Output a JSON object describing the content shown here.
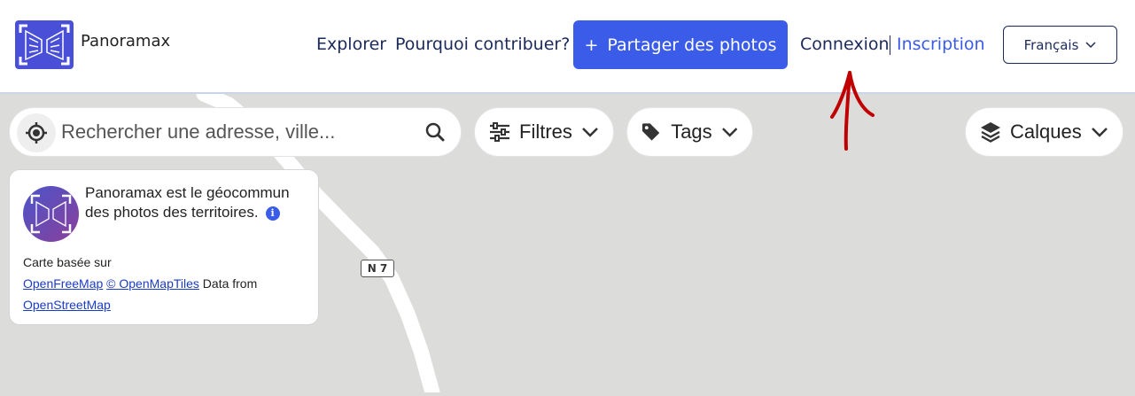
{
  "header": {
    "brand": "Panoramax",
    "nav": {
      "explore": "Explorer",
      "why": "Pourquoi contribuer?",
      "share": "Partager des photos",
      "share_plus": "+",
      "login": "Connexion",
      "signup": "Inscription"
    },
    "language": "Français"
  },
  "map": {
    "search_placeholder": "Rechercher une adresse, ville...",
    "filters_label": "Filtres",
    "tags_label": "Tags",
    "layers_label": "Calques",
    "road_label": "N 7"
  },
  "card": {
    "title": "Panoramax est le géocommun des photos des territoires.",
    "attribution_prefix": "Carte basée sur",
    "link_openfreemap": "OpenFreeMap",
    "link_openmaptiles": "© OpenMapTiles",
    "data_from": "Data from",
    "link_osm": "OpenStreetMap"
  },
  "colors": {
    "accent": "#3a5ce9",
    "navy": "#1b2a5a",
    "map_bg": "#dcdddb",
    "annotation": "#c00000"
  },
  "icons": [
    "panoramax-logo-icon",
    "locate-icon",
    "search-icon",
    "filters-icon",
    "tag-icon",
    "layers-icon",
    "chevron-down-icon",
    "info-icon"
  ]
}
